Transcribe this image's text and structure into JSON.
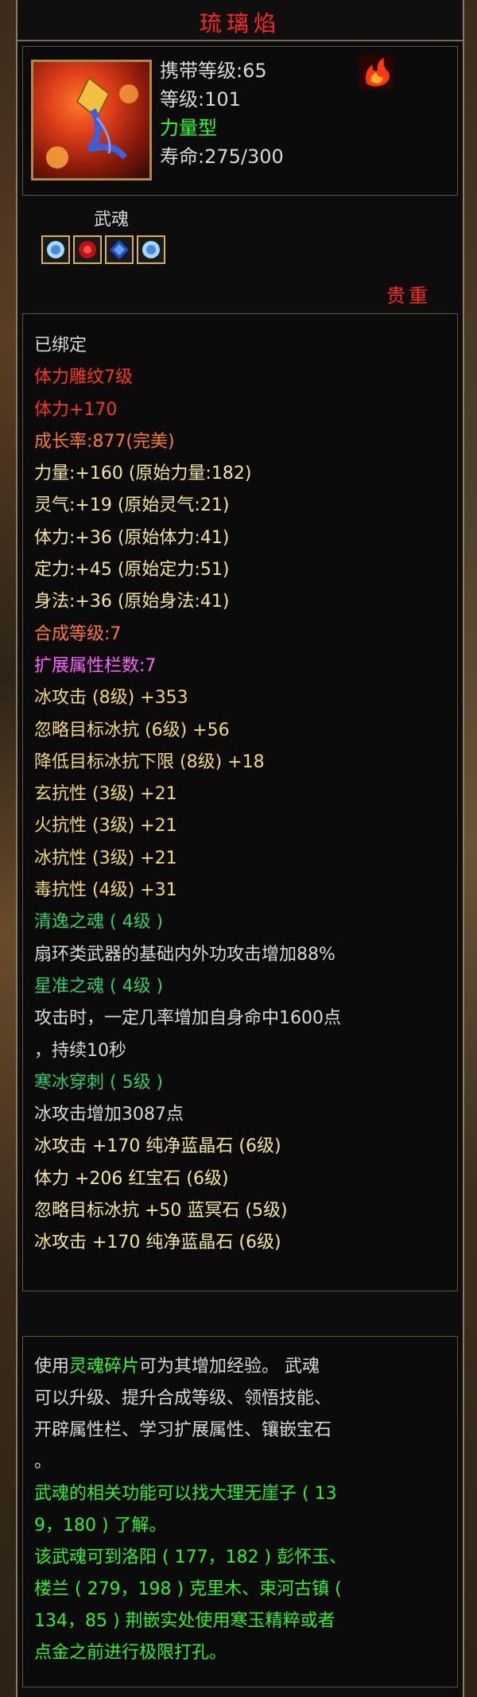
{
  "item": {
    "name": "琉璃焰",
    "stats": [
      "携带等级:65",
      "等级:101",
      "力量型",
      "寿命:275/300"
    ],
    "soul_label": "武魂",
    "rarity": "贵重",
    "gem_icons": [
      "gem-icon-blue",
      "gem-icon-red",
      "gem-icon-blue-dark",
      "gem-icon-blue"
    ],
    "colors": {
      "title": "#ff2a1a",
      "green": "#33ff33",
      "yellow": "#f2d67a",
      "red": "#ff3a1a",
      "orange": "#ff7a3a",
      "pink": "#ff66ff",
      "teal": "#33cc66",
      "white": "#d8d8d8"
    }
  },
  "attributes": [
    {
      "text": "已绑定",
      "color": "#d8d8d8"
    },
    {
      "text": "体力雕纹7级",
      "color": "#ff3a1a"
    },
    {
      "text": "体力+170",
      "color": "#ff3a1a"
    },
    {
      "text": "成长率:877(完美)",
      "color": "#ff7a3a"
    },
    {
      "text": "力量:+160 (原始力量:182)",
      "color": "#f2e4a0"
    },
    {
      "text": "灵气:+19 (原始灵气:21)",
      "color": "#f2e4a0"
    },
    {
      "text": "体力:+36 (原始体力:41)",
      "color": "#f2e4a0"
    },
    {
      "text": "定力:+45 (原始定力:51)",
      "color": "#f2e4a0"
    },
    {
      "text": "身法:+36 (原始身法:41)",
      "color": "#f2e4a0"
    },
    {
      "text": "合成等级:7",
      "color": "#ff7a3a"
    },
    {
      "text": "扩展属性栏数:7",
      "color": "#ff66ff"
    },
    {
      "text": "冰攻击 (8级) +353",
      "color": "#f2d67a"
    },
    {
      "text": "忽略目标冰抗 (6级) +56",
      "color": "#f2d67a"
    },
    {
      "text": "降低目标冰抗下限 (8级) +18",
      "color": "#f2d67a"
    },
    {
      "text": "玄抗性 (3级) +21",
      "color": "#f2d67a"
    },
    {
      "text": "火抗性 (3级) +21",
      "color": "#f2d67a"
    },
    {
      "text": "冰抗性 (3级) +21",
      "color": "#f2d67a"
    },
    {
      "text": "毒抗性 (4级) +31",
      "color": "#f2d67a"
    },
    {
      "text": "清逸之魂 ( 4级 )",
      "color": "#33cc66"
    },
    {
      "text": "扇环类武器的基础内外功攻击增加88%",
      "color": "#d8d8d8"
    },
    {
      "text": "星准之魂 ( 4级 )",
      "color": "#33cc66"
    },
    {
      "text": "攻击时，一定几率增加自身命中1600点",
      "color": "#d8d8d8"
    },
    {
      "text": "，持续10秒",
      "color": "#d8d8d8"
    },
    {
      "text": "寒冰穿刺 ( 5级 )",
      "color": "#33cc66"
    },
    {
      "text": "冰攻击增加3087点",
      "color": "#d8d8d8"
    },
    {
      "text": "冰攻击 +170 纯净蓝晶石 (6级)",
      "color": "#f2e4a0"
    },
    {
      "text": "体力 +206 红宝石 (6级)",
      "color": "#f2e4a0"
    },
    {
      "text": "忽略目标冰抗 +50 蓝冥石 (5级)",
      "color": "#f2e4a0"
    },
    {
      "text": "冰攻击 +170 纯净蓝晶石 (6级)",
      "color": "#f2e4a0"
    }
  ],
  "description": {
    "p1a": "使用",
    "p1hl": "灵魂碎片",
    "p1b": "可为其增加经验。 武魂",
    "p2": "可以升级、提升合成等级、领悟技能、",
    "p3": "开辟属性栏、学习扩展属性、镶嵌宝石",
    "p4": "。",
    "g1": "武魂的相关功能可以找大理无崖子 ( 13",
    "g2": "9，180 ) 了解。",
    "g3": "该武魂可到洛阳 ( 177，182 ) 彭怀玉、",
    "g4": "楼兰 ( 279，198 ) 克里木、束河古镇 (",
    "g5": "134，85 ) 荆嵌实处使用寒玉精粹或者",
    "g6": "点金之前进行极限打孔。"
  }
}
